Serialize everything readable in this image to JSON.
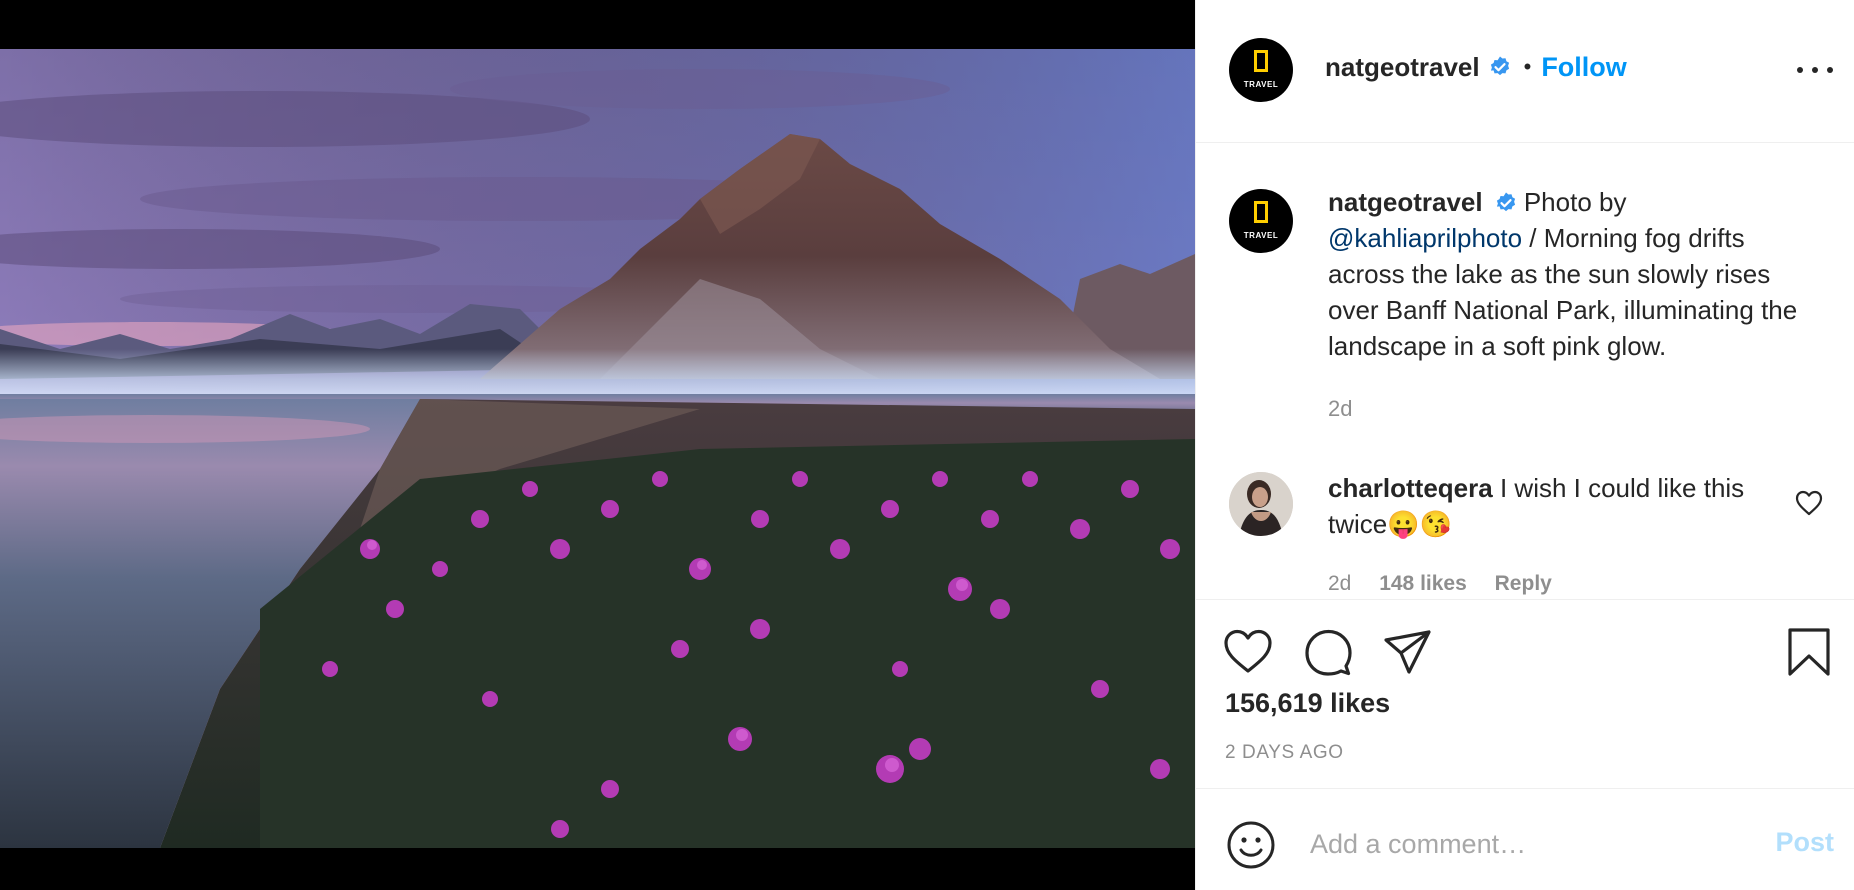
{
  "post": {
    "account": {
      "username": "natgeotravel",
      "verified": true,
      "avatar_brand": "TRAVEL",
      "separator": "•",
      "follow_label": "Follow",
      "more_icon": "more-options-icon"
    },
    "caption": {
      "username": "natgeotravel",
      "text_lead": "Photo by",
      "mention": "@kahliaprilphoto",
      "text_rest": "/ Morning fog drifts across the lake as the sun slowly rises over Banff National Park, illuminating the landscape in a soft pink glow.",
      "age": "2d"
    },
    "comments": [
      {
        "username": "charlotteqera",
        "text": "I wish I could like this twice😛😘",
        "age": "2d",
        "likes": "148 likes",
        "reply_label": "Reply"
      }
    ],
    "actions": {
      "like_icon": "heart-icon",
      "comment_icon": "comment-bubble-icon",
      "share_icon": "paper-plane-icon",
      "save_icon": "bookmark-icon"
    },
    "likes": "156,619 likes",
    "posted": "2 DAYS AGO",
    "add_comment": {
      "placeholder": "Add a comment…",
      "post_label": "Post",
      "emoji_icon": "emoji-smiley-icon"
    }
  },
  "colors": {
    "accent": "#0095f6",
    "post_disabled": "#b2dffc",
    "mention": "#00376b",
    "muted": "#8e8e8e",
    "text": "#262626",
    "brand_yellow": "#ffce00"
  }
}
